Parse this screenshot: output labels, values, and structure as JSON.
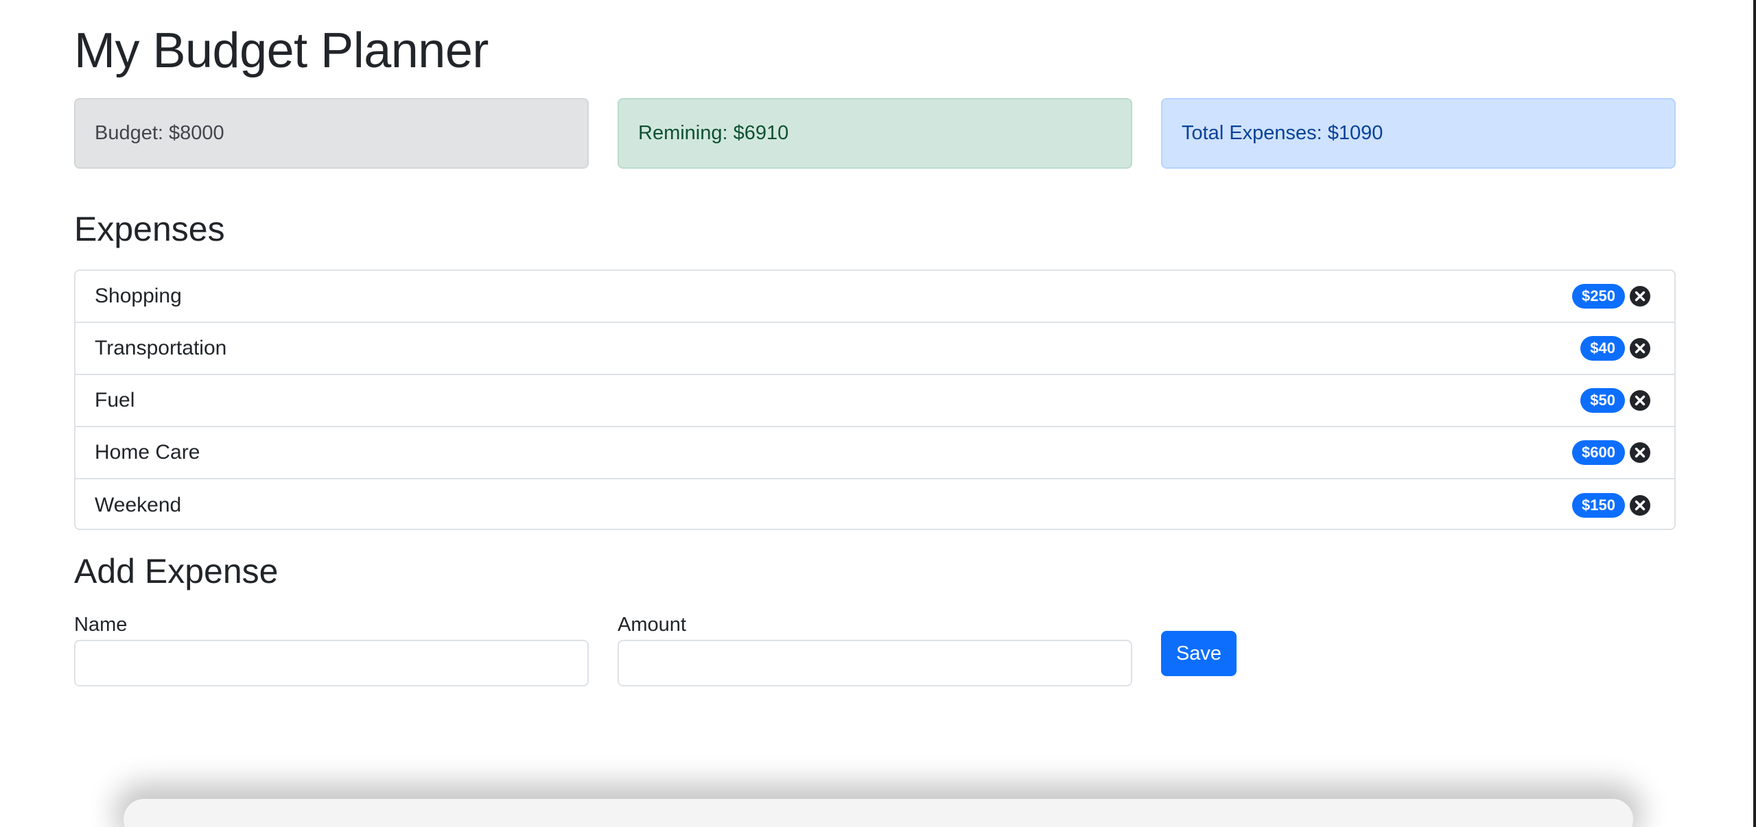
{
  "app": {
    "title": "My Budget Planner"
  },
  "stats": {
    "budget": "Budget: $8000",
    "remaining": "Remining: $6910",
    "total": "Total Expenses: $1090"
  },
  "expenses": {
    "heading": "Expenses",
    "items": [
      {
        "name": "Shopping",
        "amount": "$250"
      },
      {
        "name": "Transportation",
        "amount": "$40"
      },
      {
        "name": "Fuel",
        "amount": "$50"
      },
      {
        "name": "Home Care",
        "amount": "$600"
      },
      {
        "name": "Weekend",
        "amount": "$150"
      }
    ],
    "delete_icon": "close-circle-icon"
  },
  "add_expense": {
    "heading": "Add Expense",
    "name_label": "Name",
    "name_value": "",
    "amount_label": "Amount",
    "amount_value": "",
    "save_label": "Save"
  },
  "colors": {
    "primary": "#0d6efd",
    "budget_bg": "#e2e3e5",
    "remaining_bg": "#d1e7dd",
    "total_bg": "#cfe2ff"
  }
}
